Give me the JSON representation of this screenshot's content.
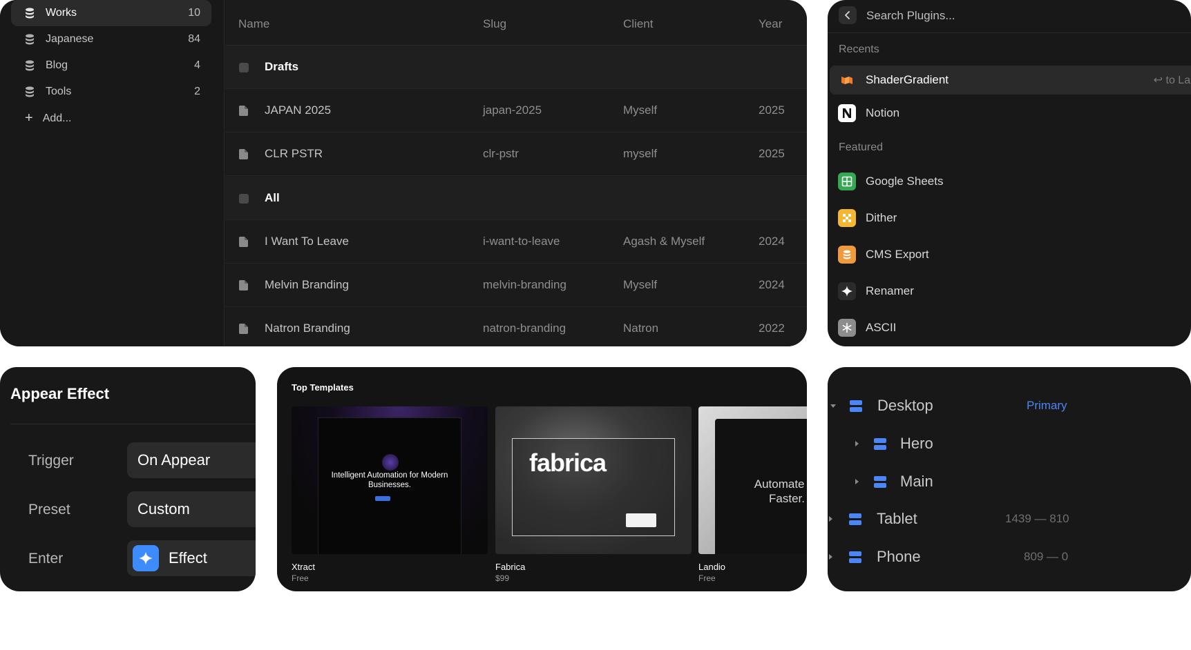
{
  "cms": {
    "collections": [
      {
        "label": "Works",
        "count": "10"
      },
      {
        "label": "Japanese",
        "count": "84"
      },
      {
        "label": "Blog",
        "count": "4"
      },
      {
        "label": "Tools",
        "count": "2"
      }
    ],
    "add_label": "Add...",
    "columns": [
      "Name",
      "Slug",
      "Client",
      "Year"
    ],
    "rows": [
      {
        "type": "group",
        "name": "Drafts"
      },
      {
        "type": "item",
        "name": "JAPAN 2025",
        "slug": "japan-2025",
        "client": "Myself",
        "year": "2025"
      },
      {
        "type": "item",
        "name": "CLR PSTR",
        "slug": "clr-pstr",
        "client": "myself",
        "year": "2025"
      },
      {
        "type": "group",
        "name": "All"
      },
      {
        "type": "item",
        "name": "I Want To Leave",
        "slug": "i-want-to-leave",
        "client": "Agash & Myself",
        "year": "2024"
      },
      {
        "type": "item",
        "name": "Melvin Branding",
        "slug": "melvin-branding",
        "client": "Myself",
        "year": "2024"
      },
      {
        "type": "item",
        "name": "Natron Branding",
        "slug": "natron-branding",
        "client": "Natron",
        "year": "2022"
      }
    ]
  },
  "plugins": {
    "search_placeholder": "Search Plugins...",
    "recents_label": "Recents",
    "featured_label": "Featured",
    "recents": [
      {
        "name": "ShaderGradient",
        "icon": "shadergradient-icon",
        "hint": "↩ to Lau"
      },
      {
        "name": "Notion",
        "icon": "notion-icon"
      }
    ],
    "featured": [
      {
        "name": "Google Sheets",
        "icon": "google-sheets-icon",
        "color": "#34a853"
      },
      {
        "name": "Dither",
        "icon": "dither-icon",
        "color": "#f5b731"
      },
      {
        "name": "CMS Export",
        "icon": "cms-export-icon",
        "color": "#f09a3e"
      },
      {
        "name": "Renamer",
        "icon": "sparkle-icon",
        "color": "#2b2b2b"
      },
      {
        "name": "ASCII",
        "icon": "asterisk-icon",
        "color": "#8d8d8d"
      }
    ]
  },
  "effect": {
    "title": "Appear Effect",
    "trigger_label": "Trigger",
    "trigger_value": "On Appear",
    "preset_label": "Preset",
    "preset_value": "Custom",
    "enter_label": "Enter",
    "enter_value": "Effect",
    "accent": "#3d8bfd"
  },
  "templates": {
    "heading": "Top Templates",
    "cards": [
      {
        "title": "Xtract",
        "price": "Free",
        "hero": "Intelligent Automation for Modern Businesses."
      },
      {
        "title": "Fabrica",
        "price": "$99",
        "hero": "fabrica"
      },
      {
        "title": "Landio",
        "price": "Free",
        "hero": "Automate Sr Faster."
      }
    ]
  },
  "breakpoints": [
    {
      "name": "Desktop",
      "meta": "Primary",
      "level": 0,
      "expanded": true
    },
    {
      "name": "Hero",
      "meta": "",
      "level": 1,
      "expanded": false
    },
    {
      "name": "Main",
      "meta": "",
      "level": 1,
      "expanded": false
    },
    {
      "name": "Tablet",
      "meta": "1439 — 810",
      "level": 0,
      "expanded": false
    },
    {
      "name": "Phone",
      "meta": "809 — 0",
      "level": 0,
      "expanded": false
    }
  ],
  "breakpoint_accent": "#4a86f5"
}
